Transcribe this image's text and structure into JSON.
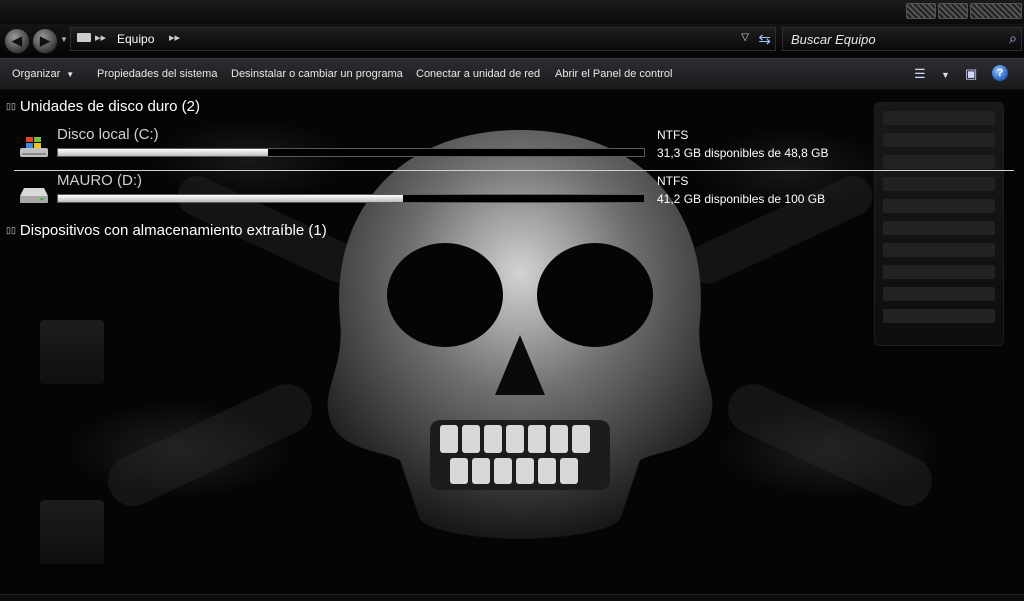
{
  "window": {
    "address": {
      "crumb": "Equipo",
      "sep1": "▸▸",
      "sep2": "▸▸"
    },
    "search": {
      "placeholder": "Buscar Equipo"
    }
  },
  "commands": {
    "organize": "Organizar",
    "items": [
      "Propiedades del sistema",
      "Desinstalar o cambiar un programa",
      "Conectar a unidad de red",
      "Abrir el Panel de control"
    ],
    "help": "?"
  },
  "groups": {
    "hard_drives": {
      "label": "Unidades de disco duro (2)"
    },
    "removable": {
      "label": "Dispositivos con almacenamiento extraíble (1)"
    }
  },
  "drives": [
    {
      "name": "Disco local (C:)",
      "fs": "NTFS",
      "free_text": "31,3 GB disponibles de 48,8 GB",
      "used_fraction": 0.359,
      "icon": "windows-drive-icon"
    },
    {
      "name": "MAURO (D:)",
      "fs": "NTFS",
      "free_text": "41,2 GB disponibles de 100 GB",
      "used_fraction": 0.588,
      "icon": "hard-drive-icon"
    }
  ],
  "colors": {
    "accent": "#9cc4ff",
    "bar_fill": "#ffffff"
  }
}
